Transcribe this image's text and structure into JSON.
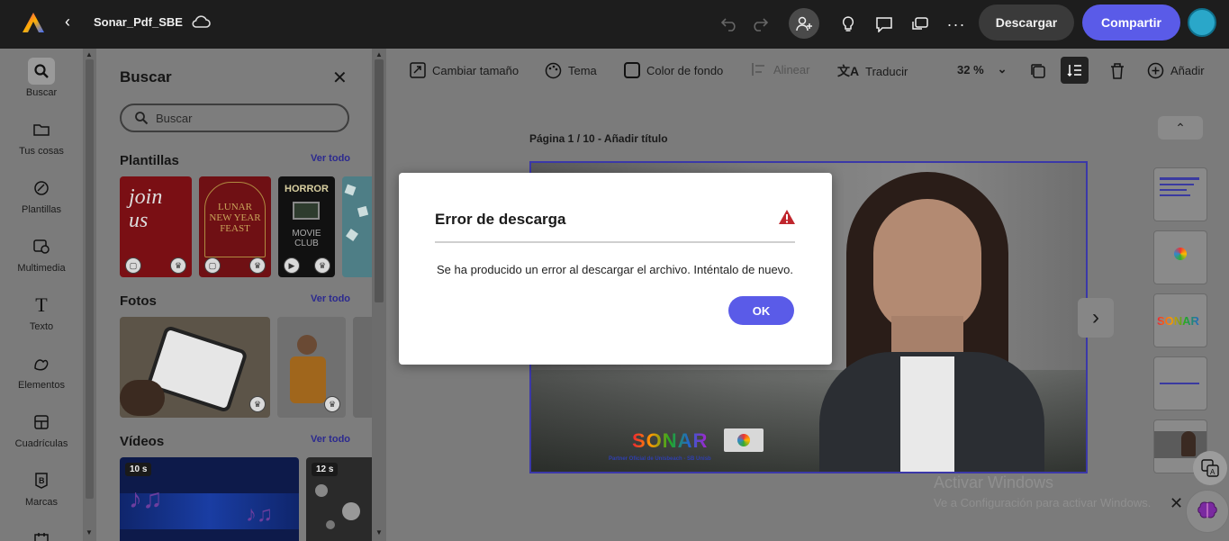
{
  "topbar": {
    "doc_name": "Sonar_Pdf_SBE",
    "download_label": "Descargar",
    "share_label": "Compartir"
  },
  "rail": {
    "items": [
      {
        "label": "Buscar",
        "icon": "search-icon"
      },
      {
        "label": "Tus cosas",
        "icon": "folder-icon"
      },
      {
        "label": "Plantillas",
        "icon": "templates-icon"
      },
      {
        "label": "Multimedia",
        "icon": "media-icon"
      },
      {
        "label": "Texto",
        "icon": "text-icon"
      },
      {
        "label": "Elementos",
        "icon": "shapes-icon"
      },
      {
        "label": "Cuadrículas",
        "icon": "grid-icon"
      },
      {
        "label": "Marcas",
        "icon": "brand-icon"
      }
    ]
  },
  "panel": {
    "title": "Buscar",
    "search_placeholder": "Buscar",
    "sections": [
      {
        "title": "Plantillas",
        "see_all": "Ver todo"
      },
      {
        "title": "Fotos",
        "see_all": "Ver todo"
      },
      {
        "title": "Vídeos",
        "see_all": "Ver todo"
      }
    ],
    "template_texts": {
      "t1": "join us",
      "t2a": "LUNAR",
      "t2b": "NEW YEAR",
      "t2c": "FEAST",
      "t3a": "HORROR",
      "t3b": "MOVIE",
      "t3c": "CLUB"
    },
    "video_durations": [
      "10 s",
      "12 s"
    ]
  },
  "canvas_toolbar": {
    "resize": "Cambiar tamaño",
    "theme": "Tema",
    "background": "Color de fondo",
    "align": "Alinear",
    "translate": "Traducir",
    "zoom": "32 %",
    "add": "Añadir"
  },
  "canvas": {
    "page_label": "Página 1 / 10 - Añadir título",
    "slide_brand": "SONAR",
    "slide_tagline": "Partner Oficial de Unisbeach - SB Unisb"
  },
  "thumbnails": {
    "brand": "SONAR"
  },
  "watermark": {
    "line1": "Activar Windows",
    "line2": "Ve a Configuración para activar Windows."
  },
  "dialog": {
    "title": "Error de descarga",
    "message": "Se ha producido un error al descargar el archivo. Inténtalo de nuevo.",
    "ok_label": "OK"
  },
  "colors": {
    "accent": "#5a5be8",
    "warning": "#c0262d"
  }
}
